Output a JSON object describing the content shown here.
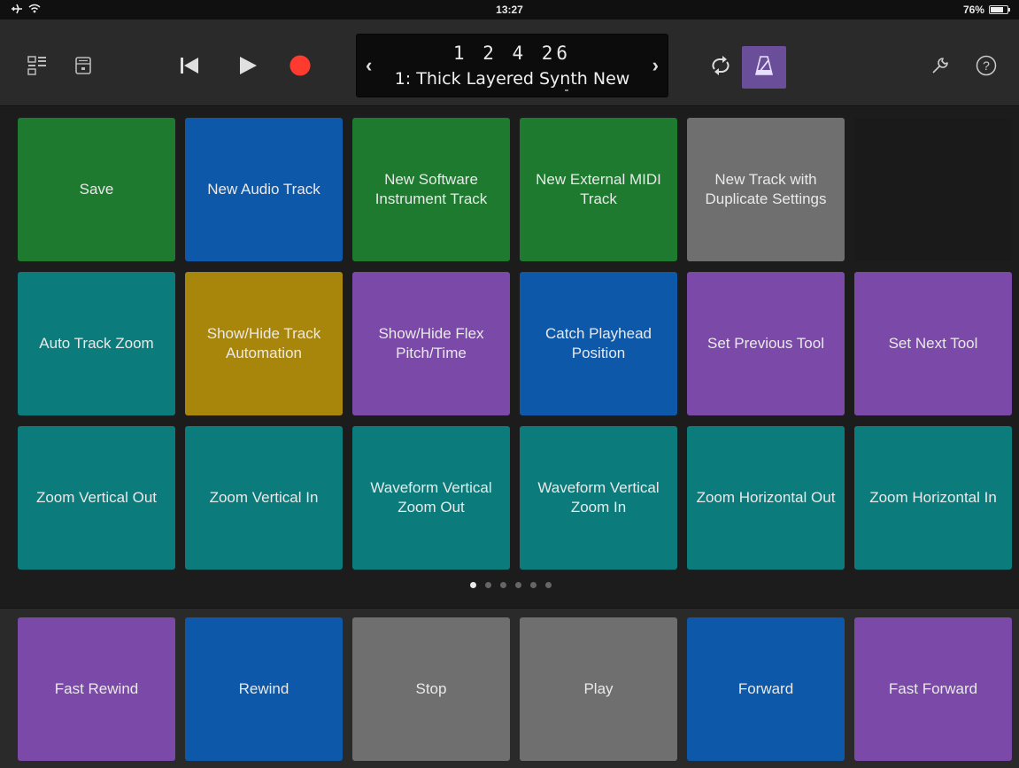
{
  "status_bar": {
    "time": "13:27",
    "battery": "76%",
    "battery_level": 0.76
  },
  "toolbar": {
    "icons": [
      "browser-icon",
      "library-icon",
      "go-to-start-icon",
      "play-icon",
      "record-icon",
      "cycle-icon",
      "metronome-icon",
      "settings-wrench-icon",
      "help-icon"
    ],
    "lcd": {
      "position": "1 2 4 26",
      "track_name": "1: Thick Layered Synth New",
      "prev": "‹",
      "next": "›"
    },
    "help_label": "?"
  },
  "pads": [
    {
      "label": "Save",
      "color": "green"
    },
    {
      "label": "New Audio Track",
      "color": "blue"
    },
    {
      "label": "New Software Instrument Track",
      "color": "green"
    },
    {
      "label": "New External MIDI Track",
      "color": "green"
    },
    {
      "label": "New Track with Duplicate Settings",
      "color": "gray"
    },
    {
      "label": "",
      "color": "dark"
    },
    {
      "label": "Auto Track Zoom",
      "color": "teal"
    },
    {
      "label": "Show/Hide Track Automation",
      "color": "gold"
    },
    {
      "label": "Show/Hide Flex Pitch/Time",
      "color": "purple"
    },
    {
      "label": "Catch Playhead Position",
      "color": "blue"
    },
    {
      "label": "Set Previous Tool",
      "color": "purple"
    },
    {
      "label": "Set Next Tool",
      "color": "purple"
    },
    {
      "label": "Zoom Vertical Out",
      "color": "teal"
    },
    {
      "label": "Zoom Vertical In",
      "color": "teal"
    },
    {
      "label": "Waveform Vertical Zoom Out",
      "color": "teal"
    },
    {
      "label": "Waveform Vertical Zoom In",
      "color": "teal"
    },
    {
      "label": "Zoom Horizontal Out",
      "color": "teal"
    },
    {
      "label": "Zoom Horizontal In",
      "color": "teal"
    }
  ],
  "page_dots": {
    "count": 6,
    "active": 0
  },
  "transport_pads": [
    {
      "label": "Fast Rewind",
      "color": "purple"
    },
    {
      "label": "Rewind",
      "color": "blue"
    },
    {
      "label": "Stop",
      "color": "gray"
    },
    {
      "label": "Play",
      "color": "gray"
    },
    {
      "label": "Forward",
      "color": "blue"
    },
    {
      "label": "Fast Forward",
      "color": "purple"
    }
  ],
  "colors": {
    "green": "#1d7a2f",
    "blue": "#0d58a8",
    "gray": "#6f6f6f",
    "teal": "#0c7b7b",
    "gold": "#a8860b",
    "purple": "#7b4aa8",
    "record": "#ff3b30",
    "metronome": "#6a4e9a"
  }
}
